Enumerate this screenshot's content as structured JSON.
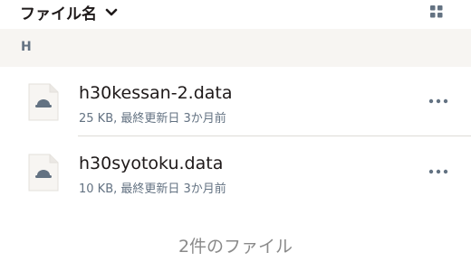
{
  "header": {
    "sort_label": "ファイル名",
    "sort_icon": "chevron-down-icon",
    "view_icon": "grid-view-icon"
  },
  "section": {
    "label": "H"
  },
  "files": [
    {
      "name": "h30kessan-2.data",
      "meta": "25 KB, 最終更新日 3か月前",
      "icon": "file-icon"
    },
    {
      "name": "h30syotoku.data",
      "meta": "10 KB, 最終更新日 3か月前",
      "icon": "file-icon"
    }
  ],
  "footer": {
    "count_text": "2件のファイル"
  },
  "colors": {
    "text_primary": "#1e1919",
    "text_secondary": "#637282",
    "section_bg": "#f7f5f2",
    "divider": "#dedbd7"
  }
}
